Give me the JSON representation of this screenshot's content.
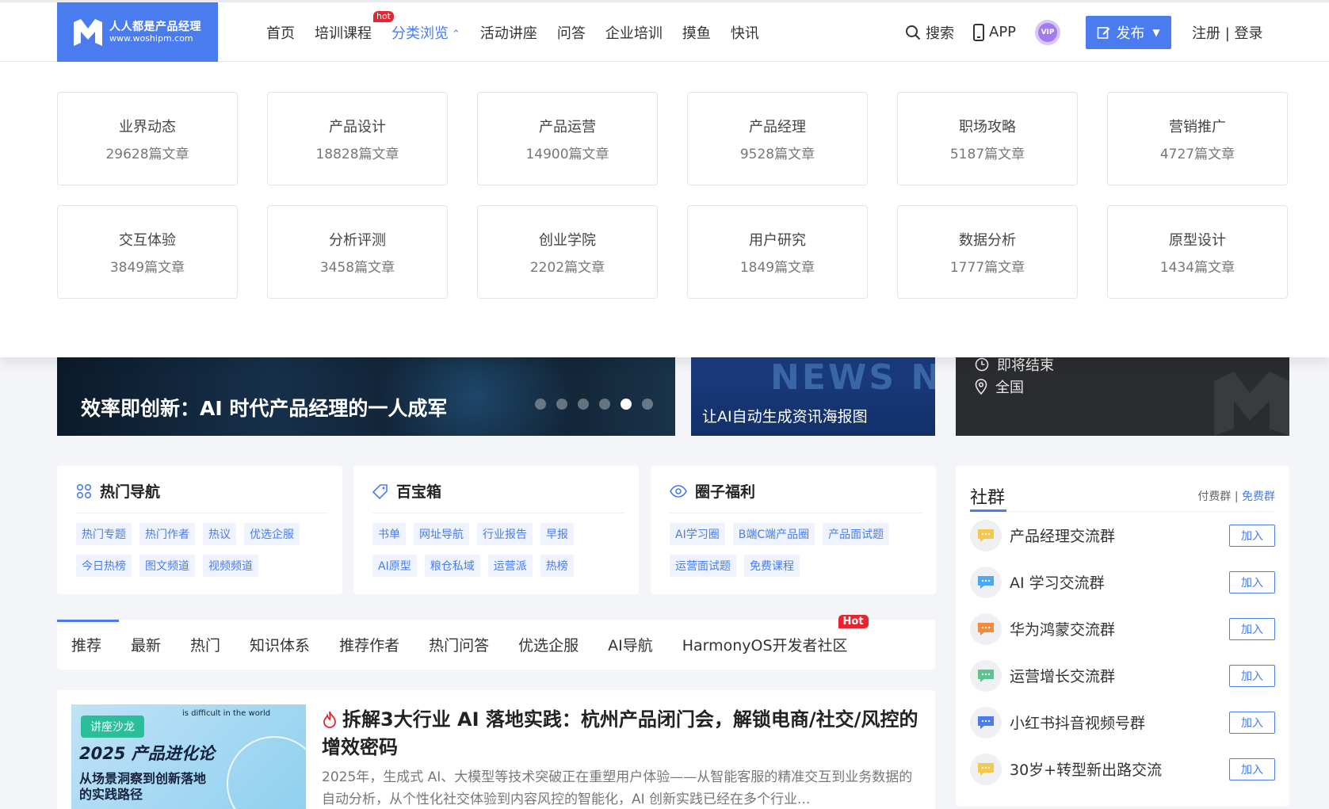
{
  "header": {
    "logo_title": "人人都是产品经理",
    "logo_url": "www.woshipm.com",
    "nav": [
      {
        "label": "首页"
      },
      {
        "label": "培训课程",
        "badge": "hot"
      },
      {
        "label": "分类浏览",
        "active": true
      },
      {
        "label": "活动讲座"
      },
      {
        "label": "问答"
      },
      {
        "label": "企业培训"
      },
      {
        "label": "摸鱼"
      },
      {
        "label": "快讯"
      }
    ],
    "search_label": "搜索",
    "app_label": "APP",
    "vip_label": "VIP",
    "publish_label": "发布",
    "auth_label": "注册 | 登录"
  },
  "categories": [
    {
      "name": "业界动态",
      "count": "29628篇文章"
    },
    {
      "name": "产品设计",
      "count": "18828篇文章"
    },
    {
      "name": "产品运营",
      "count": "14900篇文章"
    },
    {
      "name": "产品经理",
      "count": "9528篇文章"
    },
    {
      "name": "职场攻略",
      "count": "5187篇文章"
    },
    {
      "name": "营销推广",
      "count": "4727篇文章"
    },
    {
      "name": "交互体验",
      "count": "3849篇文章"
    },
    {
      "name": "分析评测",
      "count": "3458篇文章"
    },
    {
      "name": "创业学院",
      "count": "2202篇文章"
    },
    {
      "name": "用户研究",
      "count": "1849篇文章"
    },
    {
      "name": "数据分析",
      "count": "1777篇文章"
    },
    {
      "name": "原型设计",
      "count": "1434篇文章"
    }
  ],
  "banners": {
    "main_title": "效率即创新：AI 时代产品经理的一人成军",
    "carousel_count": 6,
    "carousel_active": 5,
    "second_title": "让AI自动生成资讯海报图",
    "second_deco": "NEWS NEWS",
    "event_status": "即将结束",
    "event_location": "全国"
  },
  "tool_cards": [
    {
      "title": "热门导航",
      "icon": "grid-icon",
      "tags": [
        "热门专题",
        "热门作者",
        "热议",
        "优选企服",
        "今日热榜",
        "图文频道",
        "视频频道"
      ]
    },
    {
      "title": "百宝箱",
      "icon": "tag-icon",
      "tags": [
        "书单",
        "网址导航",
        "行业报告",
        "早报",
        "AI原型",
        "粮仓私域",
        "运营派",
        "热榜"
      ]
    },
    {
      "title": "圈子福利",
      "icon": "eye-icon",
      "tags": [
        "AI学习圈",
        "B端C端产品圈",
        "产品面试题",
        "运营面试题",
        "免费课程"
      ]
    }
  ],
  "community": {
    "title": "社群",
    "link_paid": "付费群",
    "link_sep": "|",
    "link_free": "免费群",
    "join_label": "加入",
    "groups": [
      {
        "name": "产品经理交流群",
        "color": "#f5c84a"
      },
      {
        "name": "AI 学习交流群",
        "color": "#4aa8f5"
      },
      {
        "name": "华为鸿蒙交流群",
        "color": "#f58a3a"
      },
      {
        "name": "运营增长交流群",
        "color": "#5cc490"
      },
      {
        "name": "小红书抖音视频号群",
        "color": "#4a7cf0"
      },
      {
        "name": "30岁+转型新出路交流",
        "color": "#f5c84a"
      }
    ]
  },
  "tabs": [
    {
      "label": "推荐"
    },
    {
      "label": "最新"
    },
    {
      "label": "热门"
    },
    {
      "label": "知识体系"
    },
    {
      "label": "推荐作者"
    },
    {
      "label": "热门问答"
    },
    {
      "label": "优选企服"
    },
    {
      "label": "AI导航"
    },
    {
      "label": "HarmonyOS开发者社区",
      "badge": "Hot"
    }
  ],
  "article": {
    "thumb_tag": "讲座沙龙",
    "thumb_top": "is difficult in the world",
    "thumb_year": "2025 产品进化论",
    "thumb_sub1": "从场景洞察到创新落地",
    "thumb_sub2": "的实践路径",
    "title": "拆解3大行业 AI 落地实践：杭州产品闭门会，解锁电商/社交/风控的增效密码",
    "desc": "2025年，生成式 AI、大模型等技术突破正在重塑用户体验——从智能客服的精准交互到业务数据的自动分析，从个性化社交体验到内容风控的智能化，AI 创新实践已经在多个行业..."
  },
  "colors": {
    "brand": "#4a7cf0",
    "hot": "#e8242e"
  }
}
